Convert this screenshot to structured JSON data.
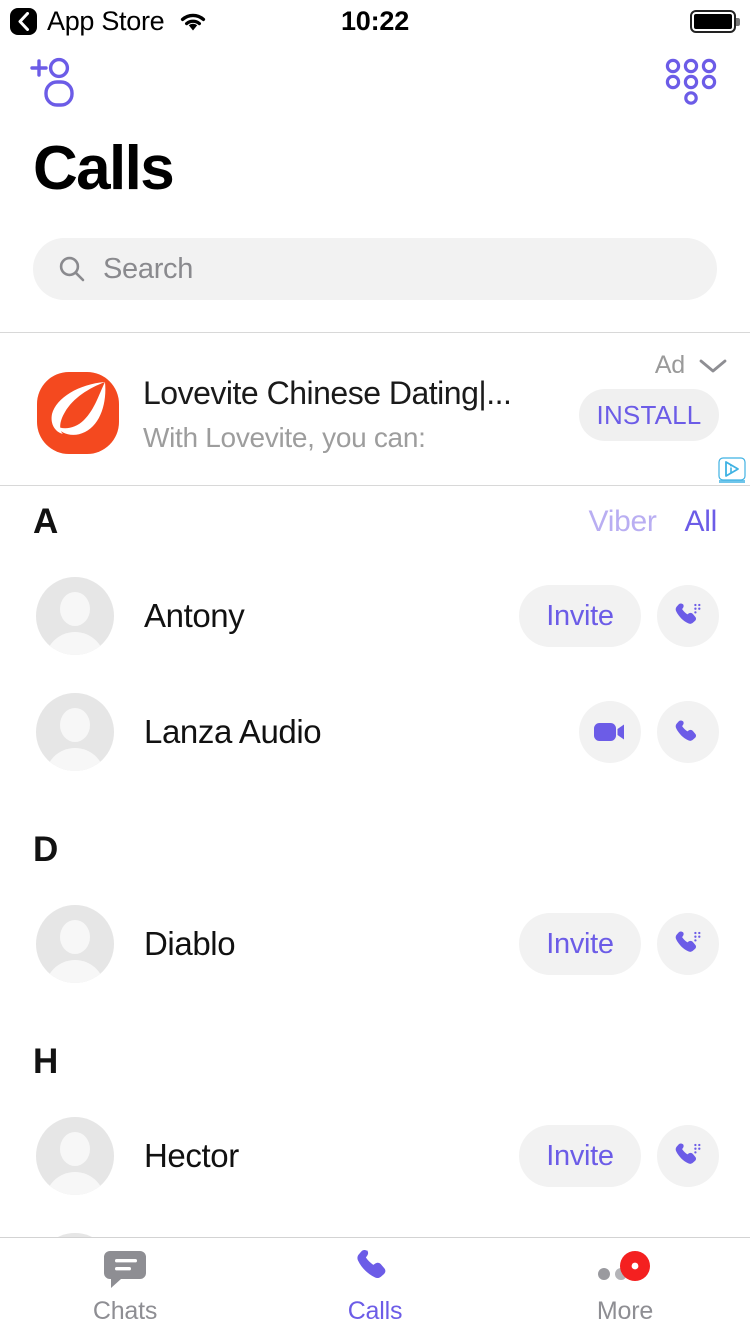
{
  "status_bar": {
    "back_label": "App Store",
    "back_icon": "chevron-left-icon",
    "wifi_icon": "wifi-icon",
    "time": "10:22",
    "battery_icon": "battery-full-icon"
  },
  "nav_bar": {
    "add_contact_icon": "add-person-icon",
    "keypad_icon": "dialpad-icon"
  },
  "header": {
    "title": "Calls"
  },
  "search": {
    "placeholder": "Search",
    "value": "",
    "icon": "search-icon"
  },
  "ad": {
    "label": "Ad",
    "chevron_icon": "chevron-down-icon",
    "app_icon": "lovevite-leaf-icon",
    "title": "Lovevite Chinese Dating|...",
    "subtitle": "With Lovevite, you can:",
    "install_label": "INSTALL",
    "adchoices_icon": "adchoices-icon"
  },
  "filters": {
    "viber_label": "Viber",
    "all_label": "All",
    "selected": "All"
  },
  "sections": [
    {
      "letter": "A",
      "show_filters": true,
      "contacts": [
        {
          "name": "Antony",
          "avatar_icon": "person-placeholder-icon",
          "invite_label": "Invite",
          "actions": [
            "invite",
            "cellular-call"
          ]
        },
        {
          "name": "Lanza Audio",
          "avatar_icon": "person-placeholder-icon",
          "invite_label": "",
          "actions": [
            "video-call",
            "voice-call"
          ]
        }
      ]
    },
    {
      "letter": "D",
      "show_filters": false,
      "contacts": [
        {
          "name": "Diablo",
          "avatar_icon": "person-placeholder-icon",
          "invite_label": "Invite",
          "actions": [
            "invite",
            "cellular-call"
          ]
        }
      ]
    },
    {
      "letter": "H",
      "show_filters": false,
      "contacts": [
        {
          "name": "Hector",
          "avatar_icon": "person-placeholder-icon",
          "invite_label": "Invite",
          "actions": [
            "invite",
            "cellular-call"
          ]
        },
        {
          "name": "",
          "avatar_icon": "person-placeholder-icon",
          "invite_label": "",
          "actions": [
            "invite",
            "cellular-call"
          ]
        }
      ]
    }
  ],
  "tab_bar": {
    "tabs": [
      {
        "label": "Chats",
        "icon": "chat-bubble-icon",
        "active": false,
        "badge": false
      },
      {
        "label": "Calls",
        "icon": "phone-icon",
        "active": true,
        "badge": false
      },
      {
        "label": "More",
        "icon": "more-dots-icon",
        "active": false,
        "badge": true
      }
    ]
  },
  "colors": {
    "accent_purple": "#6c5ce7",
    "inactive_purple": "#b9aef2",
    "gray_text": "#8e8e93",
    "ad_orange": "#f4491f",
    "badge_red": "#f42020",
    "field_gray": "#f2f2f2"
  }
}
